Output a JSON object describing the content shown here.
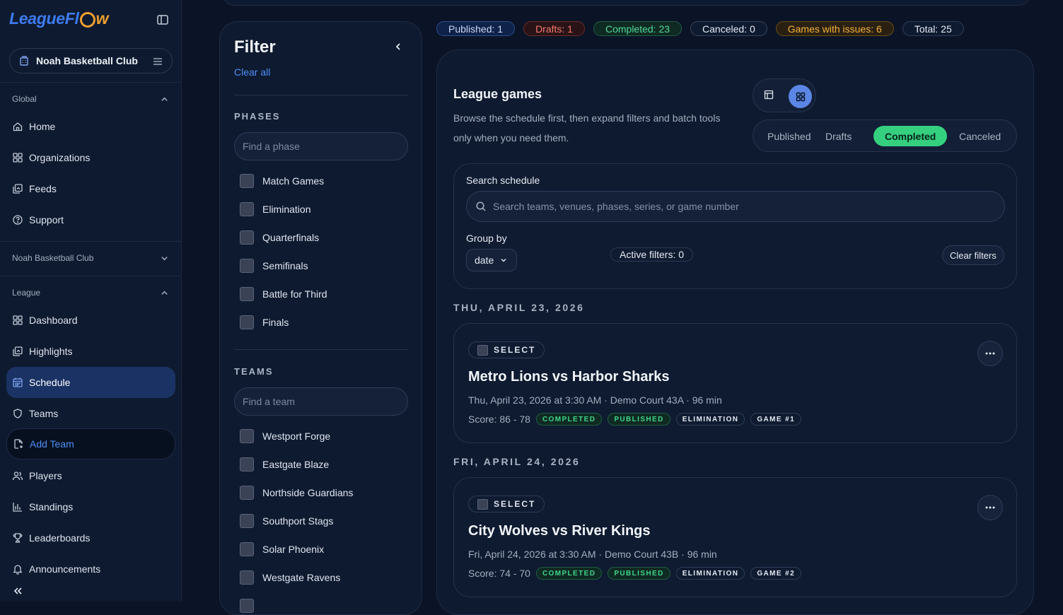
{
  "app": {
    "logo_text_a": "League",
    "logo_text_b": "Fl",
    "logo_text_c": "w",
    "accent": "#3d7bf0",
    "logo_orange": "#f0a030"
  },
  "sidebar": {
    "org_name": "Noah Basketball Club",
    "sections": {
      "global": "Global",
      "org": "Noah Basketball Club",
      "league": "League"
    },
    "global_items": [
      {
        "label": "Home",
        "icon": "home-icon"
      },
      {
        "label": "Organizations",
        "icon": "grid-icon"
      },
      {
        "label": "Feeds",
        "icon": "feeds-icon"
      },
      {
        "label": "Support",
        "icon": "help-icon"
      }
    ],
    "league_items": [
      {
        "label": "Dashboard",
        "icon": "grid-icon"
      },
      {
        "label": "Highlights",
        "icon": "highlights-icon"
      },
      {
        "label": "Schedule",
        "icon": "calendar-icon",
        "active": true
      },
      {
        "label": "Teams",
        "icon": "shield-icon"
      },
      {
        "label": "Add Team",
        "icon": "add-file-icon"
      },
      {
        "label": "Players",
        "icon": "users-icon"
      },
      {
        "label": "Standings",
        "icon": "bar-chart-icon"
      },
      {
        "label": "Leaderboards",
        "icon": "trophy-icon"
      },
      {
        "label": "Announcements",
        "icon": "bell-icon"
      }
    ]
  },
  "filter": {
    "title": "Filter",
    "clear_all": "Clear all",
    "phases_heading": "PHASES",
    "phase_placeholder": "Find a phase",
    "phases": [
      "Match Games",
      "Elimination",
      "Quarterfinals",
      "Semifinals",
      "Battle for Third",
      "Finals"
    ],
    "teams_heading": "TEAMS",
    "team_placeholder": "Find a team",
    "teams": [
      "Westport Forge",
      "Eastgate Blaze",
      "Northside Guardians",
      "Southport Stags",
      "Solar Phoenix",
      "Westgate Ravens"
    ]
  },
  "status_pills": [
    {
      "label": "Published: 1",
      "color": "#c9d6f2",
      "border": "#2d4e8f",
      "bg": "#0f2249"
    },
    {
      "label": "Drafts: 1",
      "color": "#f07a6a",
      "border": "#6b2b27",
      "bg": "#2a1317"
    },
    {
      "label": "Completed: 23",
      "color": "#52d99a",
      "border": "#1f5d44",
      "bg": "#0f2a22"
    },
    {
      "label": "Canceled: 0",
      "color": "#e6ebf3",
      "border": "#3a4560",
      "bg": "#0e1a2f"
    },
    {
      "label": "Games with issues: 6",
      "color": "#f5b13d",
      "border": "#6b4c1a",
      "bg": "#2a2012"
    },
    {
      "label": "Total: 25",
      "color": "#e6ebf3",
      "border": "#2e3c5a",
      "bg": "#0e1a2f"
    }
  ],
  "main": {
    "title": "League games",
    "description": "Browse the schedule first, then expand filters and batch tools only when you need them.",
    "segments": [
      "Published",
      "Drafts",
      "Completed",
      "Canceled"
    ],
    "active_segment": "Completed",
    "search_label": "Search schedule",
    "search_placeholder": "Search teams, venues, phases, series, or game number",
    "group_by_label": "Group by",
    "group_by_value": "date",
    "active_filters": "Active filters: 0",
    "clear_filters": "Clear filters"
  },
  "games": [
    {
      "date_heading": "THU, APRIL 23, 2026",
      "select_label": "SELECT",
      "title": "Metro Lions vs Harbor Sharks",
      "meta": "Thu, April 23, 2026 at 3:30 AM · Demo Court 43A · 96 min",
      "score": "Score: 86 - 78",
      "tags": [
        "COMPLETED",
        "PUBLISHED",
        "ELIMINATION",
        "GAME #1"
      ]
    },
    {
      "date_heading": "FRI, APRIL 24, 2026",
      "select_label": "SELECT",
      "title": "City Wolves vs River Kings",
      "meta": "Fri, April 24, 2026 at 3:30 AM · Demo Court 43B · 96 min",
      "score": "Score: 74 - 70",
      "tags": [
        "COMPLETED",
        "PUBLISHED",
        "ELIMINATION",
        "GAME #2"
      ]
    }
  ]
}
